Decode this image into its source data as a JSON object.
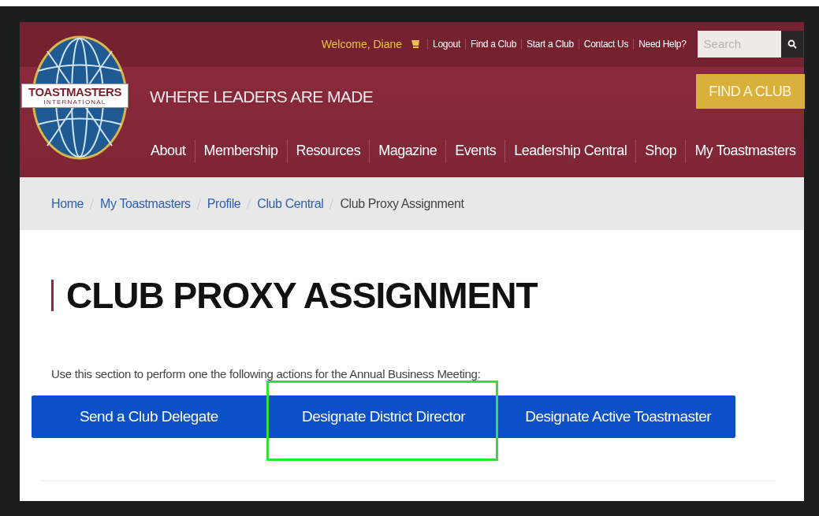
{
  "logo": {
    "wordmark": "TOASTMASTERS",
    "subtitle": "INTERNATIONAL"
  },
  "utility_bar": {
    "welcome": "Welcome, Diane",
    "links": [
      "Logout",
      "Find a Club",
      "Start a Club",
      "Contact Us",
      "Need Help?"
    ],
    "search": {
      "placeholder": "Search"
    }
  },
  "tagline": "WHERE LEADERS ARE MADE",
  "find_club_button": "FIND A CLUB",
  "nav": [
    "About",
    "Membership",
    "Resources",
    "Magazine",
    "Events",
    "Leadership Central",
    "Shop",
    "My Toastmasters"
  ],
  "breadcrumb": [
    {
      "label": "Home",
      "current": false
    },
    {
      "label": "My Toastmasters",
      "current": false
    },
    {
      "label": "Profile",
      "current": false
    },
    {
      "label": "Club Central",
      "current": false
    },
    {
      "label": "Club Proxy Assignment",
      "current": true
    }
  ],
  "title": "CLUB PROXY ASSIGNMENT",
  "description": "Use this section to perform one the following actions for the Annual Business Meeting:",
  "actions": [
    {
      "label": "Send a Club Delegate",
      "highlighted": false
    },
    {
      "label": "Designate District Director",
      "highlighted": true
    },
    {
      "label": "Designate Active Toastmaster",
      "highlighted": false
    }
  ]
}
